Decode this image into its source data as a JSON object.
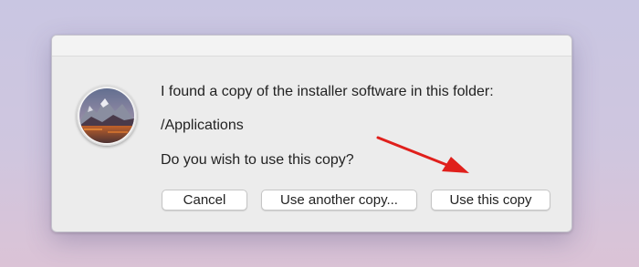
{
  "dialog": {
    "app_icon": "macos-high-sierra-installer-icon",
    "message_line1": "I found a copy of the installer software in this folder:",
    "folder_path": "/Applications",
    "question": "Do you wish to use this copy?"
  },
  "buttons": {
    "cancel_label": "Cancel",
    "use_another_label": "Use another copy...",
    "use_this_label": "Use this copy"
  },
  "annotation": {
    "icon": "red-arrow",
    "color": "#e0201c"
  }
}
